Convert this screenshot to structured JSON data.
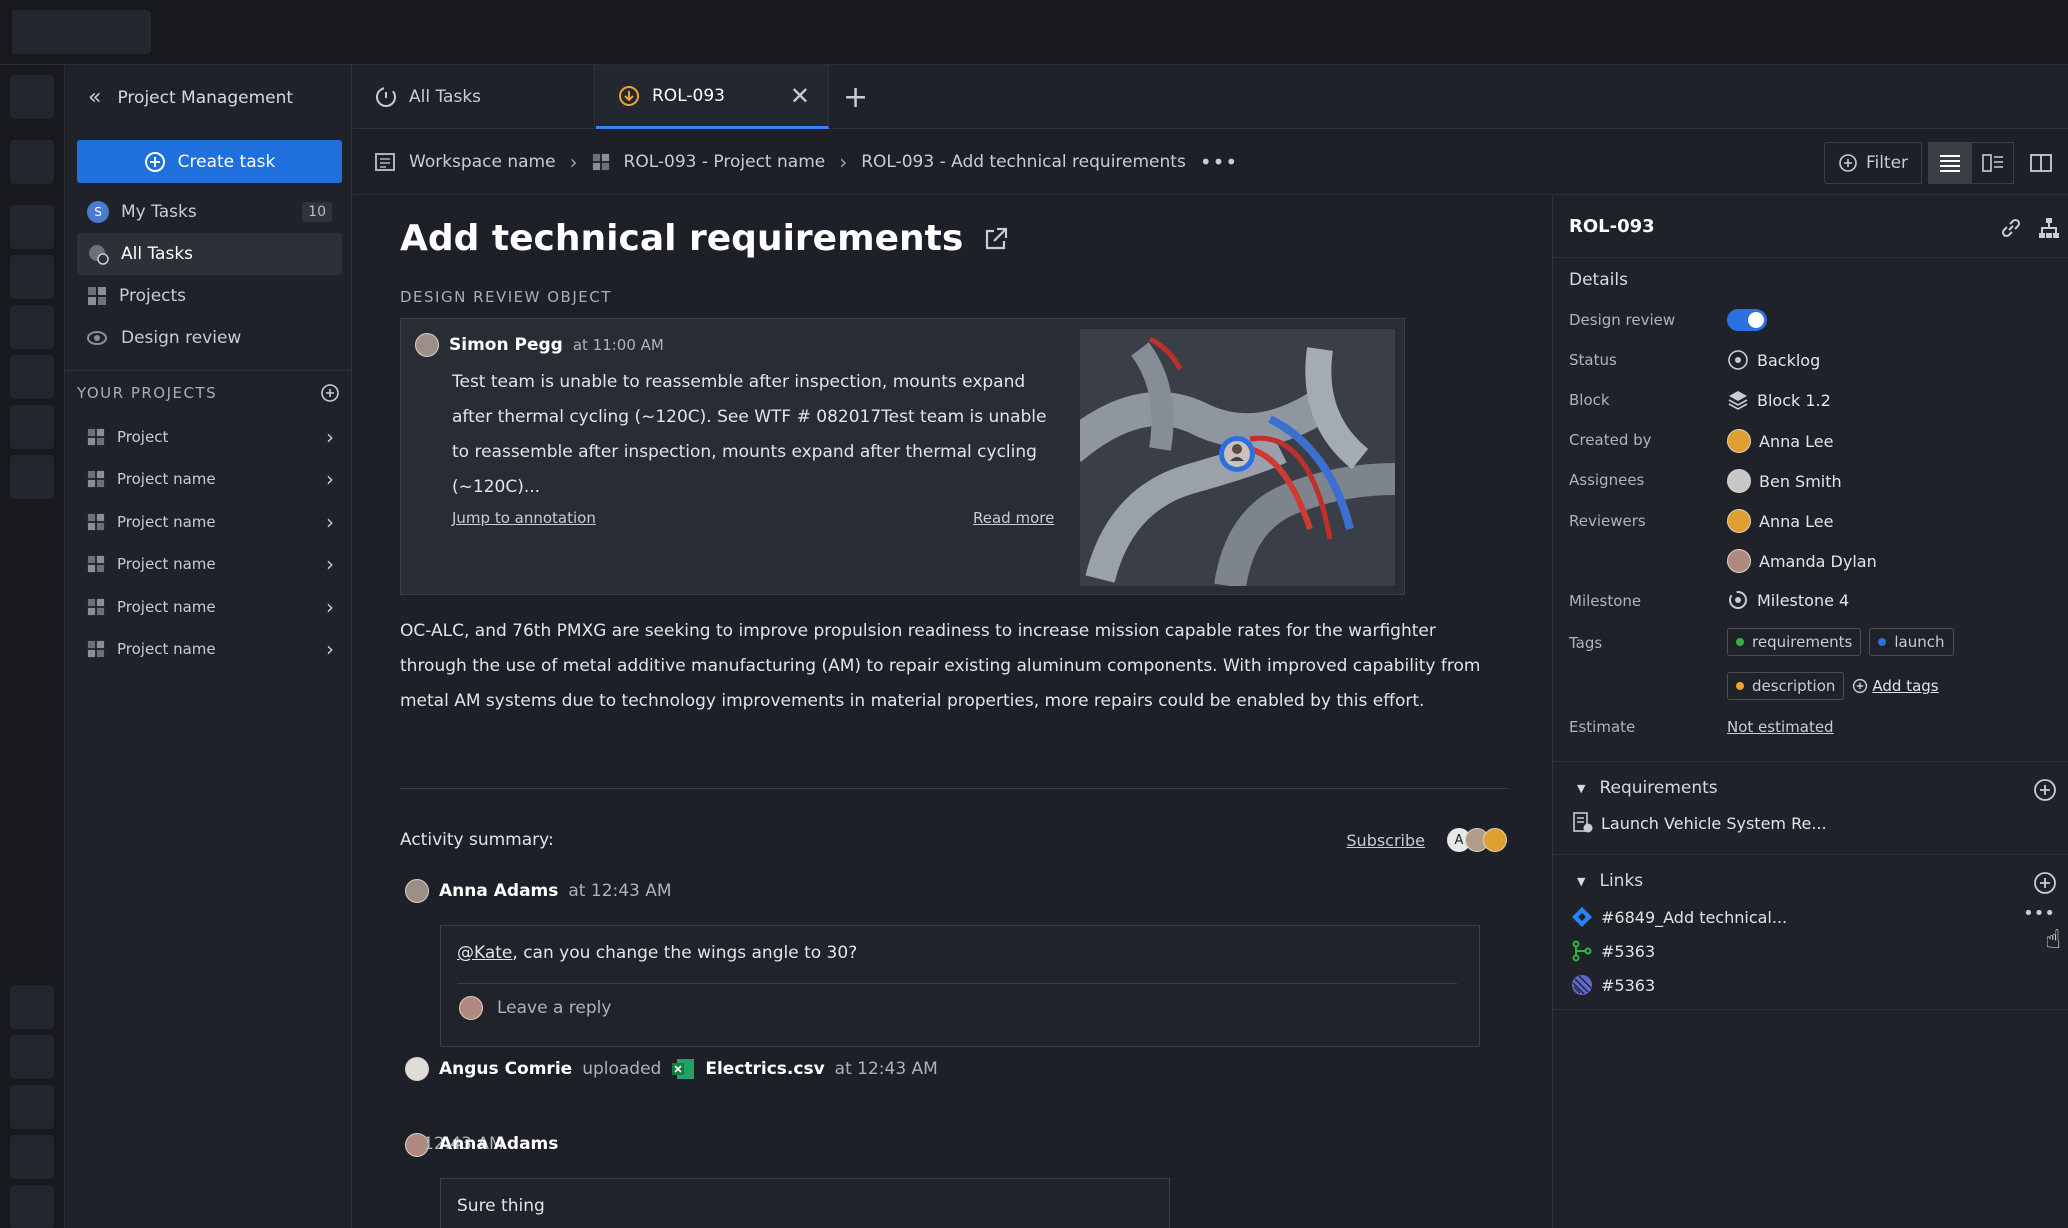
{
  "sidebar": {
    "title": "Project Management",
    "create_label": "Create task",
    "nav": [
      {
        "label": "My Tasks",
        "badge": "10",
        "icon": "user-avatar-icon"
      },
      {
        "label": "All Tasks",
        "icon": "tasks-icon"
      },
      {
        "label": "Projects",
        "icon": "projects-icon"
      },
      {
        "label": "Design review",
        "icon": "design-review-icon"
      }
    ],
    "your_projects_label": "YOUR PROJECTS",
    "projects": [
      "Project",
      "Project name",
      "Project name",
      "Project name",
      "Project name",
      "Project name"
    ]
  },
  "tabs": [
    {
      "label": "All Tasks",
      "icon": "tasks-icon"
    },
    {
      "label": "ROL-093",
      "icon": "task-status-icon"
    }
  ],
  "breadcrumb": {
    "workspace": "Workspace name",
    "project": "ROL-093 - Project name",
    "task": "ROL-093 - Add technical requirements"
  },
  "toolbar": {
    "filter_label": "Filter"
  },
  "task": {
    "title": "Add technical requirements",
    "review_heading": "DESIGN REVIEW OBJECT",
    "review": {
      "author": "Simon Pegg",
      "time": "at 11:00 AM",
      "text": "Test team is unable to reassemble after inspection, mounts expand after thermal cycling (~120C). See WTF # 082017Test team is unable to reassemble after inspection, mounts expand after thermal cycling (~120C)...",
      "jump_label": "Jump to annotation",
      "read_more_label": "Read more"
    },
    "description": "OC-ALC, and 76th PMXG are seeking to improve propulsion readiness to increase mission capable rates for the warfighter through the use of metal additive manufacturing (AM) to repair existing aluminum components. With improved capability from metal AM systems due to technology improvements in material properties, more repairs could be enabled by this effort."
  },
  "activity": {
    "label": "Activity summary:",
    "subscribe_label": "Subscribe",
    "avatar_letter": "A",
    "c1": {
      "author": "Anna Adams",
      "time": "at 12:43 AM",
      "mention": "@Kate",
      "text": ", can you change the wings angle to 30?",
      "reply_placeholder": "Leave a reply"
    },
    "c2": {
      "author": "Angus Comrie",
      "verb": "uploaded",
      "file": "Electrics.csv",
      "time": "at 12:43 AM"
    },
    "c3": {
      "author": "Anna Adams",
      "overlay_time": "12:43 AM",
      "text": "Sure thing"
    }
  },
  "details": {
    "id": "ROL-093",
    "section_label": "Details",
    "rows": {
      "design_review": "Design review",
      "status": "Status",
      "block": "Block",
      "created_by": "Created by",
      "assignees": "Assignees",
      "reviewers": "Reviewers",
      "milestone": "Milestone",
      "tags": "Tags",
      "estimate": "Estimate"
    },
    "design_review_on": true,
    "status": "Backlog",
    "block": "Block 1.2",
    "created_by": "Anna Lee",
    "assignee": "Ben Smith",
    "reviewer1": "Anna Lee",
    "reviewer2": "Amanda Dylan",
    "milestone": "Milestone 4",
    "tags": [
      {
        "label": "requirements",
        "color": "#2fb344"
      },
      {
        "label": "launch",
        "color": "#2f6fe0"
      },
      {
        "label": "description",
        "color": "#f0a030"
      }
    ],
    "add_tags_label": "Add tags",
    "estimate": "Not estimated"
  },
  "requirements": {
    "label": "Requirements",
    "item": "Launch Vehicle System Re..."
  },
  "links": {
    "label": "Links",
    "items": [
      "#6849_Add technical...",
      "#5363",
      "#5363"
    ]
  }
}
